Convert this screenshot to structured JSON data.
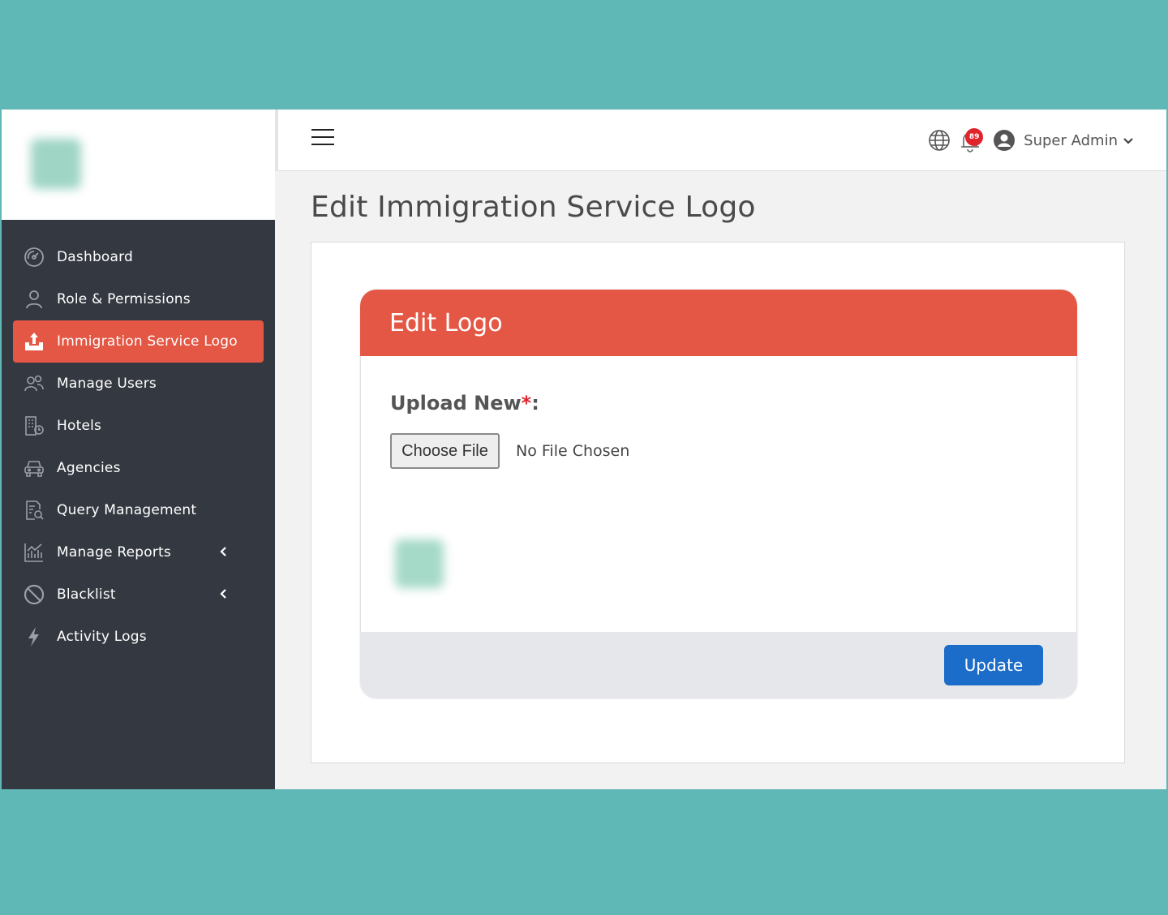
{
  "sidebar": {
    "items": [
      {
        "label": "Dashboard",
        "icon": "dashboard-icon"
      },
      {
        "label": "Role & Permissions",
        "icon": "user-icon"
      },
      {
        "label": "Immigration Service Logo",
        "icon": "upload-icon",
        "active": true
      },
      {
        "label": "Manage Users",
        "icon": "users-icon"
      },
      {
        "label": "Hotels",
        "icon": "hotel-icon"
      },
      {
        "label": "Agencies",
        "icon": "car-icon"
      },
      {
        "label": "Query Management",
        "icon": "query-icon"
      },
      {
        "label": "Manage Reports",
        "icon": "reports-icon",
        "has_submenu": true
      },
      {
        "label": "Blacklist",
        "icon": "ban-icon",
        "has_submenu": true
      },
      {
        "label": "Activity Logs",
        "icon": "bolt-icon"
      }
    ]
  },
  "header": {
    "notification_count": "89",
    "user_name": "Super Admin"
  },
  "main": {
    "page_title": "Edit Immigration Service Logo",
    "card_title": "Edit Logo",
    "upload_label": "Upload New",
    "required_mark": "*",
    "upload_label_suffix": ":",
    "choose_file_label": "Choose File",
    "no_file_text": "No File Chosen",
    "update_label": "Update"
  },
  "colors": {
    "accent": "#e35744",
    "sidebar_bg": "#343941",
    "primary_button": "#1c6cc9",
    "backdrop": "#5fb8b6",
    "badge": "#e0242d"
  }
}
